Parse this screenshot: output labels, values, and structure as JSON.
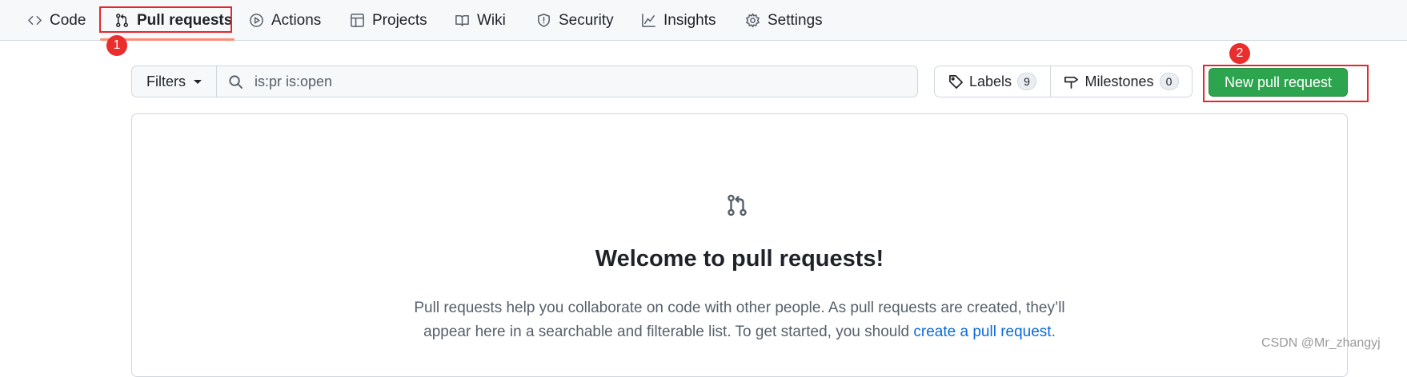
{
  "nav": {
    "tabs": [
      {
        "label": "Code",
        "icon": "code-icon"
      },
      {
        "label": "Pull requests",
        "icon": "git-pull-request-icon",
        "active": true
      },
      {
        "label": "Actions",
        "icon": "play-icon"
      },
      {
        "label": "Projects",
        "icon": "table-icon"
      },
      {
        "label": "Wiki",
        "icon": "book-icon"
      },
      {
        "label": "Security",
        "icon": "shield-icon"
      },
      {
        "label": "Insights",
        "icon": "graph-icon"
      },
      {
        "label": "Settings",
        "icon": "gear-icon"
      }
    ]
  },
  "annotations": {
    "marker1": "1",
    "marker2": "2"
  },
  "toolbar": {
    "filters_label": "Filters",
    "search_value": "is:pr is:open",
    "labels_label": "Labels",
    "labels_count": "9",
    "milestones_label": "Milestones",
    "milestones_count": "0",
    "new_pr_label": "New pull request"
  },
  "blankslate": {
    "icon": "git-pull-request-icon",
    "title": "Welcome to pull requests!",
    "desc_line1": "Pull requests help you collaborate on code with other people. As pull requests are created, they’ll",
    "desc_line2_before": "appear here in a searchable and filterable list. To get started, you should ",
    "desc_link": "create a pull request",
    "desc_line2_after": "."
  },
  "watermark": "CSDN @Mr_zhangyj",
  "colors": {
    "accent_green": "#2da44e",
    "link_blue": "#0969da",
    "active_tab_underline": "#fd8c73",
    "annotation_red": "#e5262c"
  }
}
